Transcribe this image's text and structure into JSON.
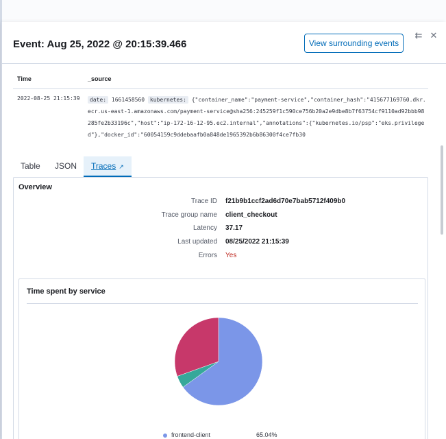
{
  "flyout": {
    "title": "Event: Aug 25, 2022 @ 20:15:39.466",
    "view_surrounding_label": "View surrounding events",
    "collapse_icon": "collapse-icon",
    "close_icon": "close-icon"
  },
  "doc_table": {
    "columns": [
      "Time",
      "_source"
    ],
    "time": "2022-08-25 21:15:39",
    "source": {
      "date_key": "date:",
      "date_value": "1661458560",
      "kubernetes_key": "kubernetes:",
      "kubernetes_value": "{\"container_name\":\"payment-service\",\"container_hash\":\"415677169760.dkr.ecr.us-east-1.amazonaws.com/payment-service@sha256:245259f1c590ce756b20a2e9dbe8b7f63754cf9110ad92bbb98285fe2b33196c\",\"host\":\"ip-172-16-12-95.ec2.internal\",\"annotations\":{\"kubernetes.io/psp\":\"eks.privileged\"},\"docker_id\":\"60054159c9ddebaafb0a848de1965392b6b86300f4ce7fb30"
    }
  },
  "tabs": {
    "table": "Table",
    "json": "JSON",
    "traces": "Traces",
    "traces_icon": "external-link-icon"
  },
  "overview": {
    "title": "Overview",
    "fields": [
      {
        "label": "Trace ID",
        "value": "f21b9b1ccf2ad6d70e7bab5712f409b0"
      },
      {
        "label": "Trace group name",
        "value": "client_checkout"
      },
      {
        "label": "Latency",
        "value": "37.17"
      },
      {
        "label": "Last updated",
        "value": "08/25/2022 21:15:39"
      },
      {
        "label": "Errors",
        "value": "Yes"
      }
    ]
  },
  "time_spent": {
    "title": "Time spent by service"
  },
  "colors": {
    "accent": "#006bb8",
    "error": "#bd271e",
    "frontend_client": "#7b96e8",
    "slice_red": "#c7386a",
    "slice_teal": "#36a89a"
  },
  "chart_data": {
    "type": "pie",
    "title": "",
    "series": [
      {
        "name": "frontend-client",
        "value": 65.04
      },
      {
        "name": "",
        "value": 4.5
      },
      {
        "name": "",
        "value": 30.46
      }
    ],
    "legend": [
      {
        "name": "frontend-client",
        "value": "65.04%"
      }
    ]
  }
}
